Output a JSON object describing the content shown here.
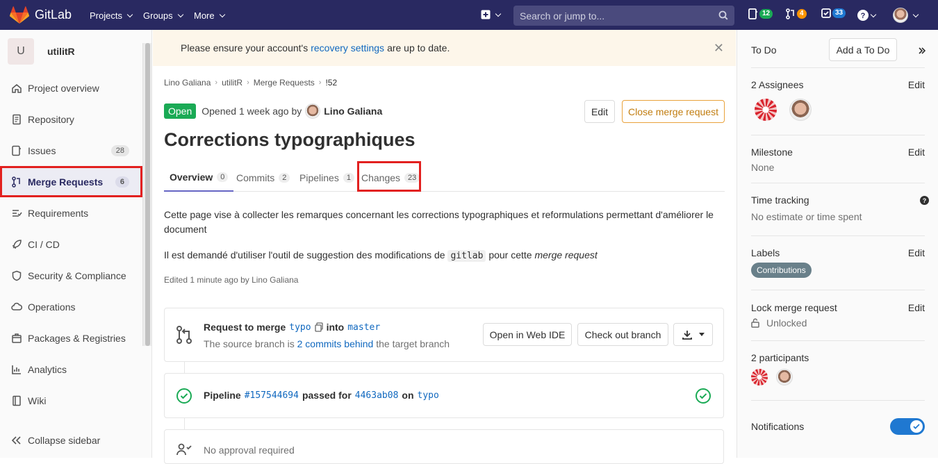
{
  "navbar": {
    "brand": "GitLab",
    "menu": [
      "Projects",
      "Groups",
      "More"
    ],
    "search_placeholder": "Search or jump to...",
    "counts": {
      "issues": "12",
      "merge_requests": "4",
      "todos": "33"
    }
  },
  "sidebar": {
    "project_initial": "U",
    "project_name": "utilitR",
    "items": [
      {
        "label": "Project overview",
        "icon": "home-icon"
      },
      {
        "label": "Repository",
        "icon": "doc-icon"
      },
      {
        "label": "Issues",
        "icon": "issues-icon",
        "count": "28"
      },
      {
        "label": "Merge Requests",
        "icon": "merge-request-icon",
        "count": "6"
      },
      {
        "label": "Requirements",
        "icon": "requirements-icon"
      },
      {
        "label": "CI / CD",
        "icon": "rocket-icon"
      },
      {
        "label": "Security & Compliance",
        "icon": "shield-icon"
      },
      {
        "label": "Operations",
        "icon": "cloud-icon"
      },
      {
        "label": "Packages & Registries",
        "icon": "package-icon"
      },
      {
        "label": "Analytics",
        "icon": "chart-icon"
      },
      {
        "label": "Wiki",
        "icon": "book-icon"
      }
    ],
    "collapse_label": "Collapse sidebar"
  },
  "alert": {
    "before": "Please ensure your account's",
    "link": "recovery settings",
    "after": "are up to date."
  },
  "breadcrumb": [
    "Lino Galiana",
    "utilitR",
    "Merge Requests",
    "!52"
  ],
  "mr": {
    "state": "Open",
    "opened_text": "Opened 1 week ago by",
    "author": "Lino Galiana",
    "edit_label": "Edit",
    "close_label": "Close merge request",
    "title": "Corrections typographiques",
    "tabs": [
      {
        "label": "Overview",
        "count": "0"
      },
      {
        "label": "Commits",
        "count": "2"
      },
      {
        "label": "Pipelines",
        "count": "1"
      },
      {
        "label": "Changes",
        "count": "23"
      }
    ],
    "desc1": "Cette page vise à collecter les remarques concernant les corrections typographiques et reformulations permettant d'améliorer le document",
    "desc2_before": "Il est demandé d'utiliser l'outil de suggestion des modifications de",
    "desc2_code": "gitlab",
    "desc2_after": "pour cette",
    "desc2_em": "merge request",
    "edited": "Edited 1 minute ago by Lino Galiana"
  },
  "merge_widget": {
    "request_label": "Request to merge",
    "source_branch": "typo",
    "into_label": "into",
    "target_branch": "master",
    "behind_before": "The source branch is",
    "behind_link": "2 commits behind",
    "behind_after": "the target branch",
    "web_ide_label": "Open in Web IDE",
    "checkout_label": "Check out branch"
  },
  "pipeline": {
    "label": "Pipeline",
    "id": "#157544694",
    "passed_for": "passed for",
    "commit": "4463ab08",
    "on": "on",
    "branch": "typo"
  },
  "approval": {
    "text": "No approval required"
  },
  "right_sidebar": {
    "todo_label": "To Do",
    "add_todo": "Add a To Do",
    "assignees_title": "2 Assignees",
    "edit": "Edit",
    "milestone_title": "Milestone",
    "milestone_value": "None",
    "time_title": "Time tracking",
    "time_value": "No estimate or time spent",
    "labels_title": "Labels",
    "label_value": "Contributions",
    "lock_title": "Lock merge request",
    "lock_value": "Unlocked",
    "participants_title": "2 participants",
    "notifications_title": "Notifications",
    "notifications_on": true
  },
  "colors": {
    "navbar": "#292961",
    "open_badge": "#1aaa55",
    "highlight": "#e2201f",
    "link": "#1068bf"
  }
}
